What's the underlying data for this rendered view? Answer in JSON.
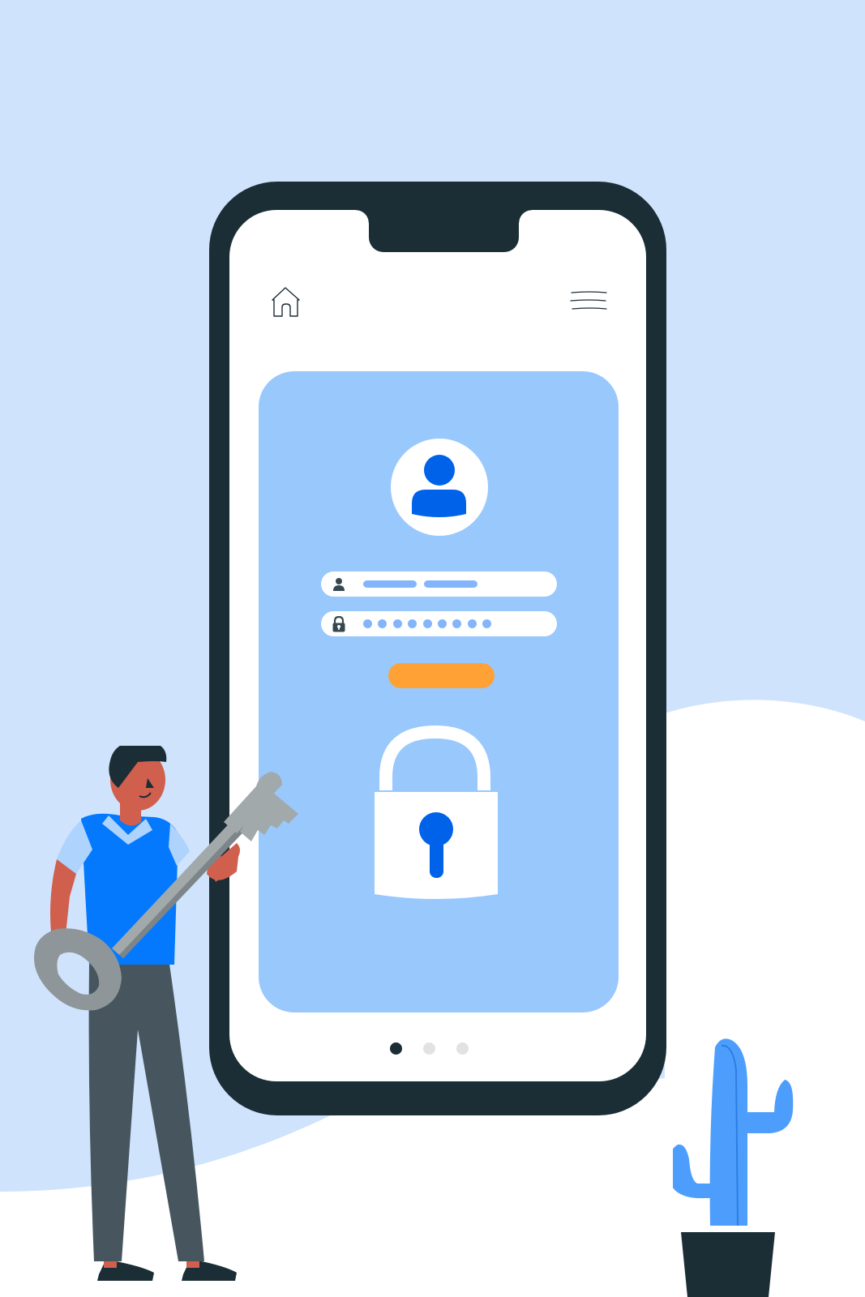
{
  "scene": {
    "colors": {
      "sky": "#cfe3fd",
      "ground": "#ffffff",
      "phone_frame": "#1b2d35",
      "card": "#99c8fd",
      "accent_blue": "#0062e8",
      "field_placeholder": "#84b5fb",
      "button": "#ffa135",
      "cactus": "#4d9efc"
    }
  },
  "header": {
    "home_icon": "home-icon",
    "menu_icon": "hamburger-menu-icon"
  },
  "login_card": {
    "avatar_icon": "user-avatar-icon",
    "username_field": {
      "icon": "user-icon",
      "value": ""
    },
    "password_field": {
      "icon": "lock-icon",
      "masked_length": 9
    },
    "submit_button": {
      "label": ""
    },
    "illustration": "padlock-icon"
  },
  "pagination": {
    "count": 3,
    "active_index": 0
  }
}
